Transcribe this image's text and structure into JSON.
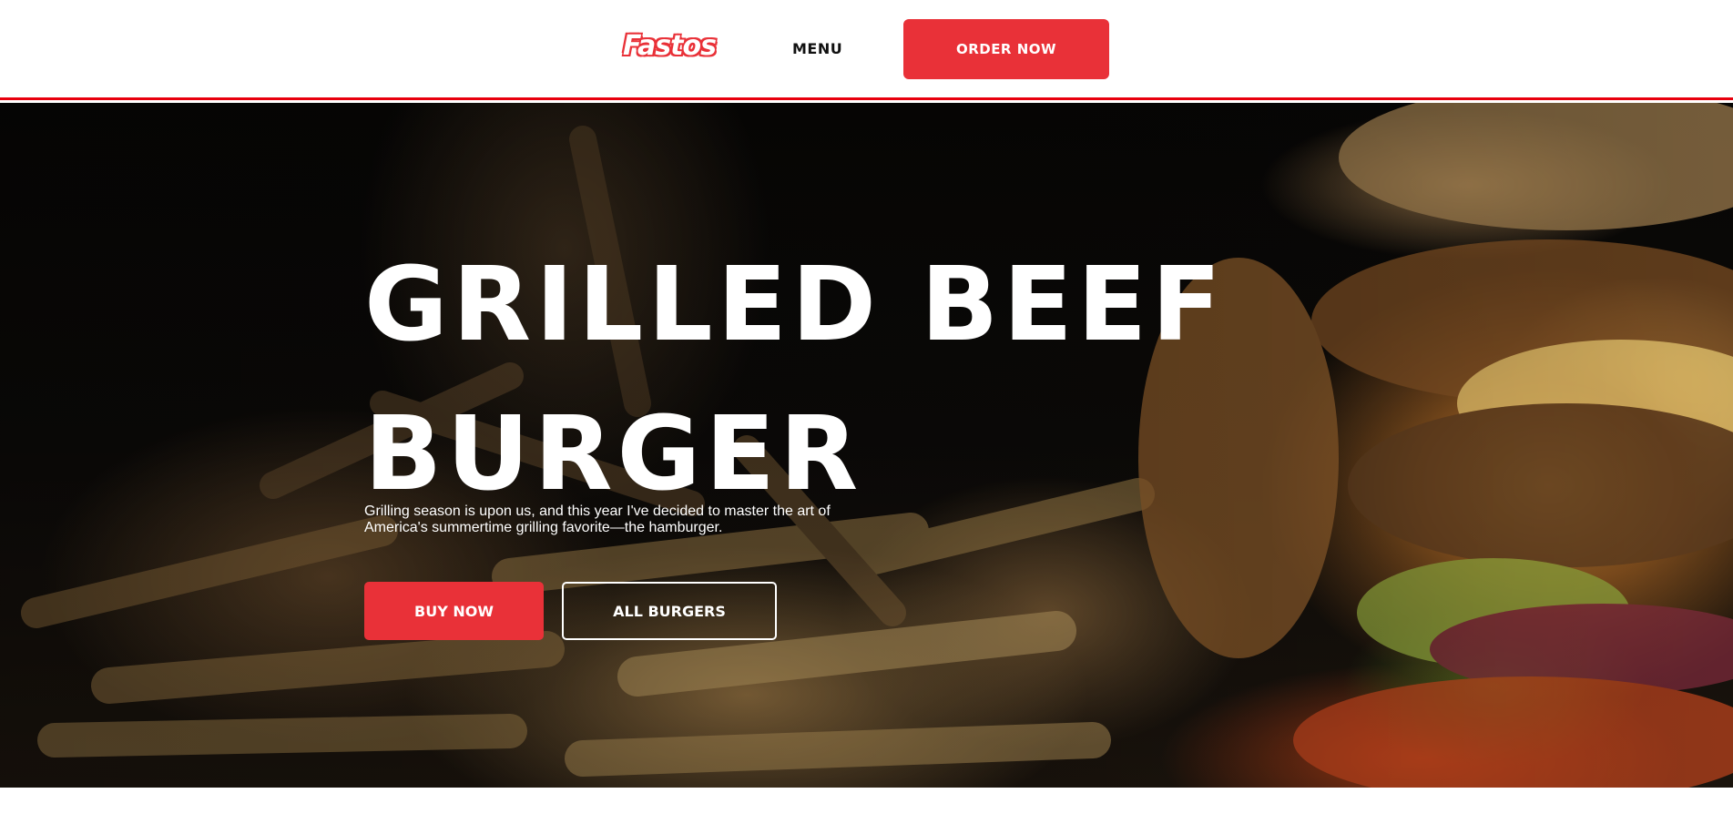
{
  "header": {
    "logo_text": "Fastos",
    "nav_menu_label": "MENU",
    "order_button_label": "ORDER NOW"
  },
  "hero": {
    "title_line1": "GRILLED BEEF",
    "title_line2": "BURGER",
    "description": "Grilling season is upon us, and this year I've decided to master the art of America's summertime grilling favorite—the hamburger.",
    "buy_button_label": "BUY NOW",
    "all_burgers_button_label": "ALL BURGERS",
    "background_image": "burger-and-fries-photo"
  },
  "colors": {
    "brand_red": "#e93138",
    "header_border": "#e8000d",
    "text_light": "#ffffff",
    "text_dark": "#111111"
  }
}
